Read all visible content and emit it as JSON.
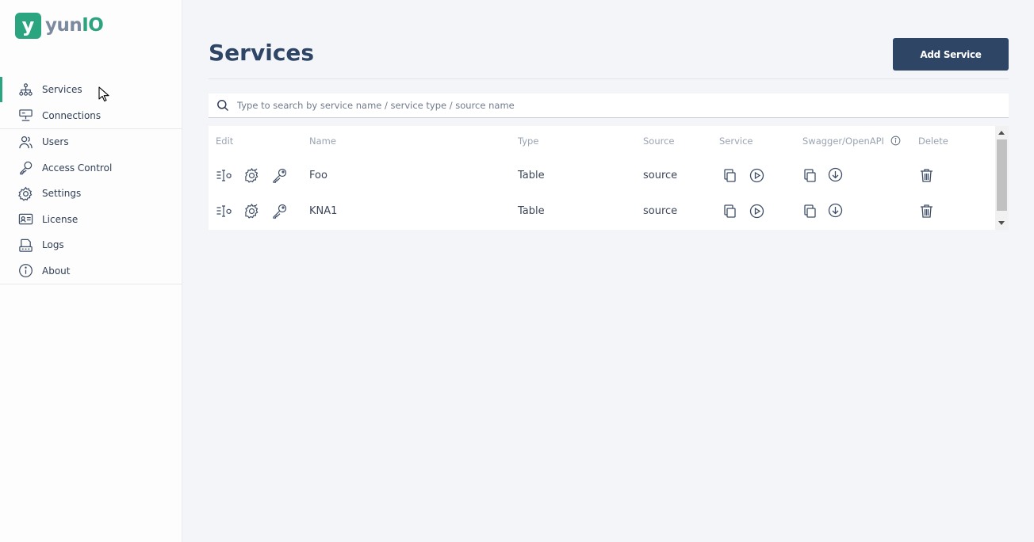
{
  "brand": {
    "logo_letter": "y",
    "name_prefix": "yun",
    "name_suffix": "IO",
    "accent": "#2aa57f",
    "navy": "#2f4566"
  },
  "sidebar": {
    "items": [
      {
        "label": "Services",
        "icon": "sitemap-icon",
        "active": true
      },
      {
        "label": "Connections",
        "icon": "connections-icon"
      },
      {
        "label": "Users",
        "icon": "users-icon"
      },
      {
        "label": "Access Control",
        "icon": "key-icon"
      },
      {
        "label": "Settings",
        "icon": "gear-icon"
      },
      {
        "label": "License",
        "icon": "id-card-icon"
      },
      {
        "label": "Logs",
        "icon": "logs-icon"
      },
      {
        "label": "About",
        "icon": "info-icon"
      }
    ]
  },
  "header": {
    "title": "Services",
    "add_button": "Add Service"
  },
  "search": {
    "placeholder": "Type to search by service name / service type / source name",
    "icon": "search-icon"
  },
  "table": {
    "columns": [
      "Edit",
      "Name",
      "Type",
      "Source",
      "Service",
      "Swagger/OpenAPI",
      "Delete"
    ],
    "rows": [
      {
        "name": "Foo",
        "type": "Table",
        "source": "source"
      },
      {
        "name": "KNA1",
        "type": "Table",
        "source": "source"
      }
    ]
  }
}
